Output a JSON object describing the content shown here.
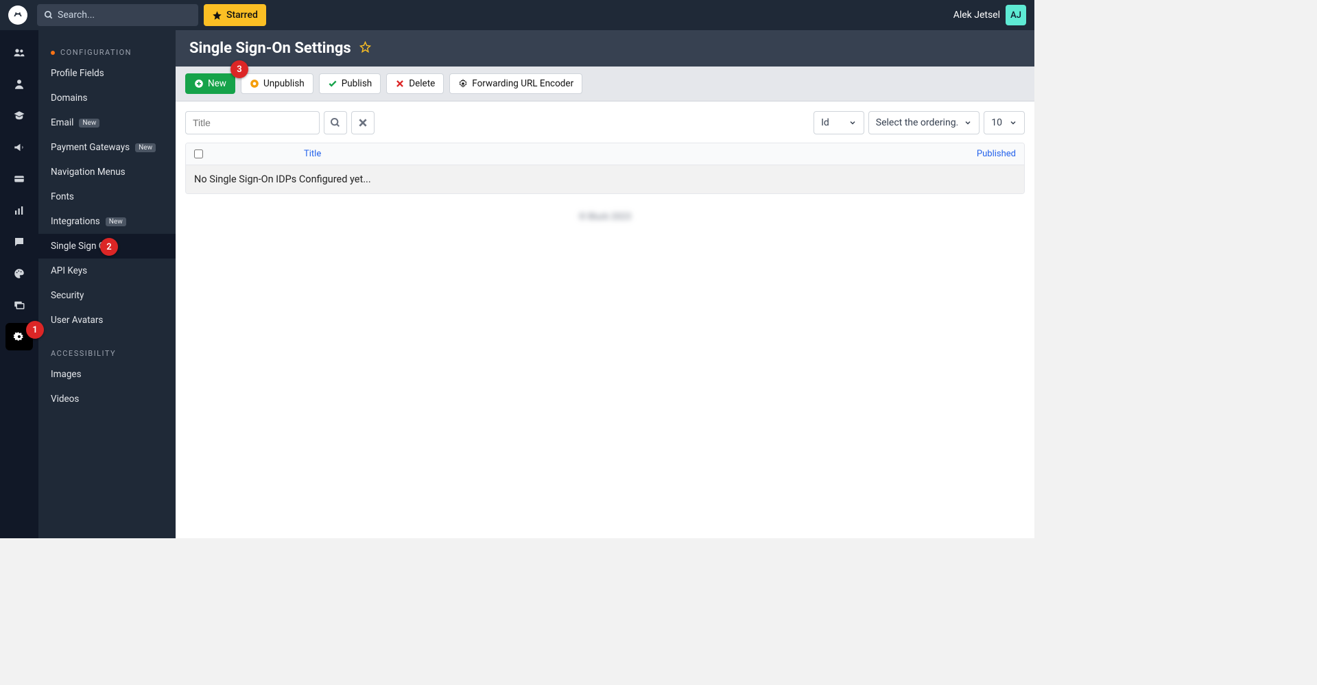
{
  "header": {
    "search_placeholder": "Search...",
    "starred_label": "Starred",
    "user_name": "Alek Jetsel",
    "user_initials": "AJ"
  },
  "sidebar": {
    "section1_title": "CONFIGURATION",
    "items": [
      {
        "label": "Profile Fields",
        "badge": null
      },
      {
        "label": "Domains",
        "badge": null
      },
      {
        "label": "Email",
        "badge": "New"
      },
      {
        "label": "Payment Gateways",
        "badge": "New"
      },
      {
        "label": "Navigation Menus",
        "badge": null
      },
      {
        "label": "Fonts",
        "badge": null
      },
      {
        "label": "Integrations",
        "badge": "New"
      },
      {
        "label": "Single Sign On",
        "badge": null
      },
      {
        "label": "API Keys",
        "badge": null
      },
      {
        "label": "Security",
        "badge": null
      },
      {
        "label": "User Avatars",
        "badge": null
      }
    ],
    "section2_title": "ACCESSIBILITY",
    "items2": [
      {
        "label": "Images"
      },
      {
        "label": "Videos"
      }
    ]
  },
  "page": {
    "title": "Single Sign-On Settings"
  },
  "toolbar": {
    "new_label": "New",
    "unpublish_label": "Unpublish",
    "publish_label": "Publish",
    "delete_label": "Delete",
    "forwarding_label": "Forwarding URL Encoder"
  },
  "filters": {
    "title_placeholder": "Title",
    "sort_field": "Id",
    "sort_order": "Select the ordering.",
    "page_size": "10"
  },
  "table": {
    "col_title": "Title",
    "col_published": "Published",
    "empty_message": "No Single Sign-On IDPs Configured yet..."
  },
  "footer": {
    "text": "© Blurb 2023"
  },
  "annotations": {
    "a1": "1",
    "a2": "2",
    "a3": "3"
  }
}
